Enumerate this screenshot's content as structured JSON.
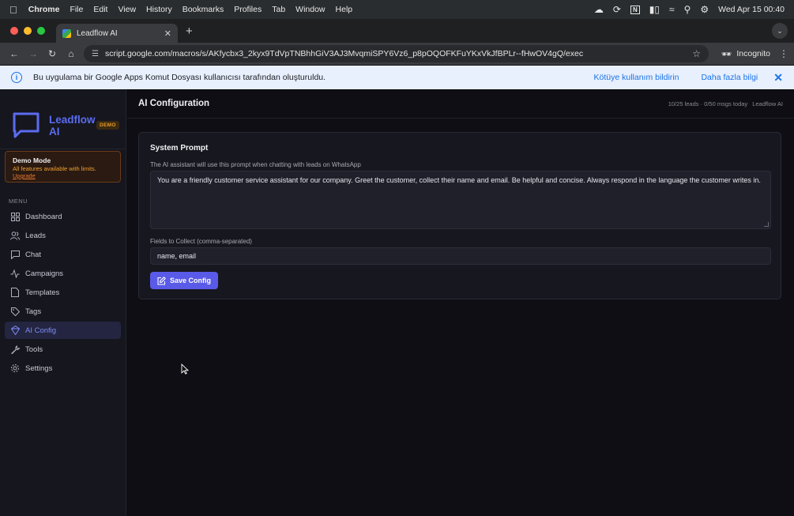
{
  "menubar": {
    "app": "Chrome",
    "items": [
      "File",
      "Edit",
      "View",
      "History",
      "Bookmarks",
      "Profiles",
      "Tab",
      "Window",
      "Help"
    ],
    "clock": "Wed Apr 15  00:40"
  },
  "browser": {
    "tab_title": "Leadflow AI",
    "url": "script.google.com/macros/s/AKfycbx3_2kyx9TdVpTNBhhGiV3AJ3MvqmiSPY6Vz6_p8pOQOFKFuYKxVkJfBPLr--fHwOV4gQ/exec",
    "profile_label": "Incognito"
  },
  "infobar": {
    "message": "Bu uygulama bir Google Apps Komut Dosyası kullanıcısı tarafından oluşturuldu.",
    "report_link": "Kötüye kullanım bildirin",
    "more_link": "Daha fazla bilgi"
  },
  "sidebar": {
    "brand": "Leadflow AI",
    "badge": "DEMO",
    "demo": {
      "title": "Demo Mode",
      "subtitle": "All features available with limits.",
      "upgrade": "Upgrade"
    },
    "menu_label": "MENU",
    "items": [
      {
        "label": "Dashboard",
        "icon": "grid-icon"
      },
      {
        "label": "Leads",
        "icon": "users-icon"
      },
      {
        "label": "Chat",
        "icon": "chat-icon"
      },
      {
        "label": "Campaigns",
        "icon": "activity-icon"
      },
      {
        "label": "Templates",
        "icon": "file-icon"
      },
      {
        "label": "Tags",
        "icon": "tag-icon"
      },
      {
        "label": "AI Config",
        "icon": "brain-icon",
        "active": true
      },
      {
        "label": "Tools",
        "icon": "wrench-icon"
      },
      {
        "label": "Settings",
        "icon": "gear-icon"
      }
    ]
  },
  "main": {
    "title": "AI Configuration",
    "stats": "10/25 leads · 0/50 msgs today",
    "app_name": "Leadflow AI",
    "card": {
      "title": "System Prompt",
      "prompt_help": "The AI assistant will use this prompt when chatting with leads on WhatsApp",
      "prompt_value": "You are a friendly customer service assistant for our company. Greet the customer, collect their name and email. Be helpful and concise. Always respond in the language the customer writes in.",
      "fields_label": "Fields to Collect (comma-separated)",
      "fields_value": "name, email",
      "save_label": "Save Config"
    }
  },
  "colors": {
    "accent": "#5a5ae8",
    "brand": "#5b6cf0",
    "demo_warning": "#e59a2c",
    "background": "#0e0e14"
  }
}
